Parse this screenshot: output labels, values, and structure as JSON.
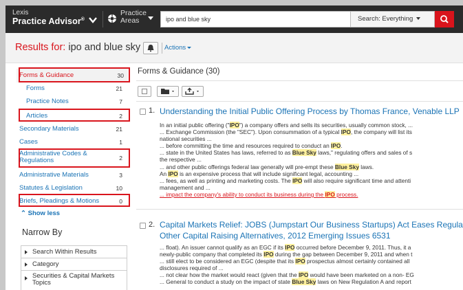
{
  "header": {
    "logo_line1": "Lexis",
    "logo_line2": "Practice Advisor",
    "logo_mark": "®",
    "practice_line1": "Practice",
    "practice_line2": "Areas",
    "search_value": "ipo and blue sky",
    "scope_label": "Search: Everything",
    "icons": [
      "chevron-down-icon",
      "practice-areas-icon",
      "search-icon"
    ],
    "brand_color": "#d9141c"
  },
  "results_bar": {
    "label": "Results for:",
    "query": " ipo and blue sky",
    "actions_label": "Actions",
    "icons": [
      "bell-icon"
    ]
  },
  "sidebar": {
    "facets": [
      {
        "label": "Forms & Guidance",
        "count": "30"
      },
      {
        "label": "Forms",
        "count": "21"
      },
      {
        "label": "Practice Notes",
        "count": "7"
      },
      {
        "label": "Articles",
        "count": "2"
      },
      {
        "label": "Secondary Materials",
        "count": "21"
      },
      {
        "label": "Cases",
        "count": "1"
      },
      {
        "label": "Administrative Codes & Regulations",
        "count": "2"
      },
      {
        "label": "Administrative Materials",
        "count": "3"
      },
      {
        "label": "Statutes & Legislation",
        "count": "10"
      },
      {
        "label": "Briefs, Pleadings & Motions",
        "count": "0"
      }
    ],
    "show_less": "Show less",
    "narrow_by": "Narrow By",
    "narrow_items": [
      "Search Within Results",
      "Category",
      "Securities & Capital Markets Topics"
    ]
  },
  "main": {
    "title": "Forms & Guidance (30)",
    "results": [
      {
        "num": "1.",
        "title": "Understanding the Initial Public Offering Process by Thomas France, Venable LLP",
        "snippets": [
          {
            "parts": [
              "In an initial public offering (\"",
              "IPO",
              "\") a company offers and sells its securities, usually common stock, ..."
            ]
          },
          {
            "parts": [
              "... Exchange Commission (the \"SEC\"). Upon consummation of a typical ",
              "IPO",
              ", the company will list its"
            ]
          },
          {
            "parts": [
              "national securities ..."
            ]
          },
          {
            "parts": [
              "... before committing the time and resources required to conduct an ",
              "IPO",
              "."
            ]
          },
          {
            "parts": [
              "... state in the United States has laws, referred to as ",
              "Blue Sky",
              " laws,\" regulating offers and sales of s"
            ]
          },
          {
            "parts": [
              "the respective ..."
            ]
          },
          {
            "parts": [
              "... and other public offerings federal law generally will pre-empt these ",
              "Blue Sky",
              " laws."
            ]
          },
          {
            "parts": [
              "An ",
              "IPO",
              " is an expensive process that will include significant legal, accounting ..."
            ]
          },
          {
            "parts": [
              "... fees, as well as printing and marketing costs. The ",
              "IPO",
              " will also require significant time and attenti"
            ]
          },
          {
            "parts": [
              "management and ..."
            ]
          },
          {
            "parts": [
              "... impact the company's ability to conduct its business during the ",
              "IPO",
              " process."
            ],
            "red": true
          }
        ]
      },
      {
        "num": "2.",
        "title_line1": "Capital Markets Relief: JOBS (Jumpstart Our Business Startups) Act Eases Regula",
        "title_line2": "Other Capital Raising Alternatives, 2012 Emerging Issues 6531",
        "snippets": [
          {
            "parts": [
              "... float). An issuer cannot qualify as an EGC if its ",
              "IPO",
              " occurred before December 9, 2011. Thus, it a"
            ]
          },
          {
            "parts": [
              "newly-public company that completed its ",
              "IPO",
              " during the gap between December 9, 2011 and when t"
            ]
          },
          {
            "parts": [
              "... still elect to be considered an EGC (despite that its ",
              "IPO",
              " prospectus almost certainly contained all"
            ]
          },
          {
            "parts": [
              "disclosures required of ..."
            ]
          },
          {
            "parts": [
              "... not clear how the market would react (given that the ",
              "IPO",
              " would have been marketed on a non- EG"
            ]
          },
          {
            "parts": [
              "... General to conduct a study on the impact of state ",
              "Blue Sky",
              " laws on New Regulation A and report"
            ]
          }
        ]
      }
    ]
  }
}
